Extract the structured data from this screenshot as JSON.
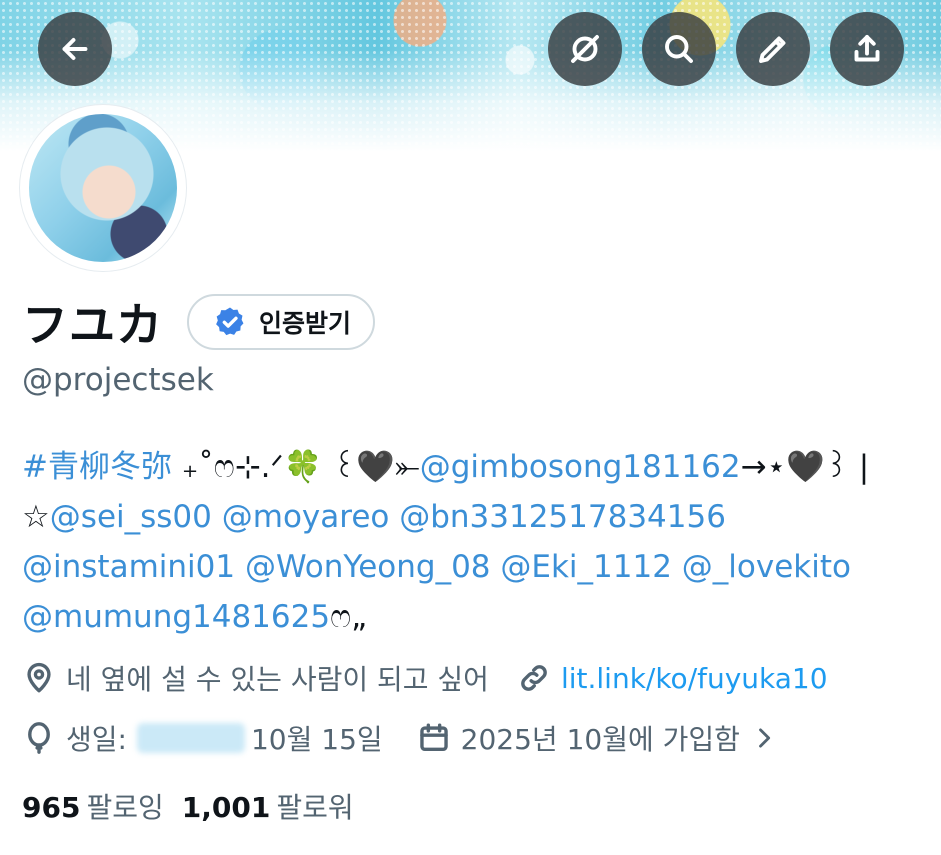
{
  "profile": {
    "display_name": "フユカ",
    "verify_button_label": "인증받기",
    "handle": "@projectsek"
  },
  "bio": {
    "line1": [
      {
        "text": "#青柳冬弥",
        "type": "hashtag"
      },
      {
        "text": " ₊˚ෆ⊹.ᐟ🍀 ꒰🖤⤜",
        "type": "text"
      },
      {
        "text": "@gimbosong181162",
        "type": "mention"
      },
      {
        "text": "→⋆🖤꒱ |",
        "type": "text"
      }
    ],
    "line2": [
      {
        "text": "☆",
        "type": "text"
      },
      {
        "text": "@sei_ss00",
        "type": "mention"
      },
      {
        "text": " ",
        "type": "text"
      },
      {
        "text": "@moyareo",
        "type": "mention"
      },
      {
        "text": " ",
        "type": "text"
      },
      {
        "text": "@bn3312517834156",
        "type": "mention"
      }
    ],
    "line3": [
      {
        "text": "@instamini01",
        "type": "mention"
      },
      {
        "text": " ",
        "type": "text"
      },
      {
        "text": "@WonYeong_08",
        "type": "mention"
      },
      {
        "text": " ",
        "type": "text"
      },
      {
        "text": "@Eki_1112",
        "type": "mention"
      },
      {
        "text": " ",
        "type": "text"
      },
      {
        "text": "@_lovekito",
        "type": "mention"
      }
    ],
    "line4": [
      {
        "text": "@mumung1481625",
        "type": "mention"
      },
      {
        "text": "ෆ„",
        "type": "text"
      }
    ]
  },
  "meta": {
    "location": "네 옆에 설 수 있는 사람이 되고 싶어",
    "website": "lit.link/ko/fuyuka10",
    "birthday_label": "생일:",
    "birthday_value": "10월 15일",
    "joined": "2025년 10월에 가입함"
  },
  "stats": {
    "following_count": "965",
    "following_label": "팔로잉",
    "followers_count": "1,001",
    "followers_label": "팔로워"
  },
  "icons": {
    "back": "arrow-left-icon",
    "hidden": "eye-slash-icon",
    "search": "search-icon",
    "edit": "pencil-icon",
    "share": "share-icon",
    "verified": "verified-badge-icon",
    "location": "location-pin-icon",
    "link": "link-icon",
    "birthday": "balloon-icon",
    "calendar": "calendar-icon",
    "chevron": "chevron-right-icon"
  },
  "colors": {
    "link": "#3b8fd6",
    "secondary_text": "#536471",
    "verified": "#3b82e6"
  }
}
